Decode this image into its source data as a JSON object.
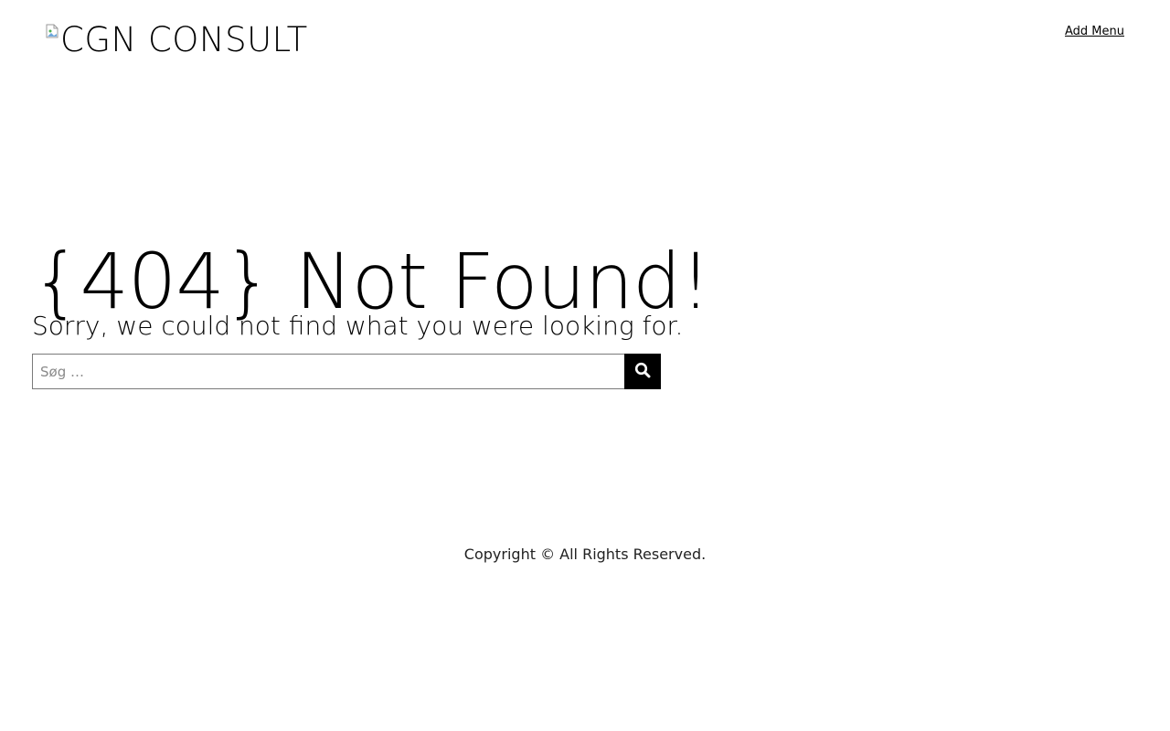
{
  "header": {
    "logo_text": "CGN CONSULT",
    "logo_icon": "broken-image-icon",
    "menu_link": "Add Menu"
  },
  "main": {
    "title": "{404} Not Found!",
    "subtitle": "Sorry, we could not find what you were looking for."
  },
  "search": {
    "placeholder": "Søg …",
    "value": "",
    "button_icon": "search-icon"
  },
  "footer": {
    "copyright": "Copyright © All Rights Reserved."
  },
  "colors": {
    "background": "#ffffff",
    "text": "#000000",
    "button_bg": "#000000",
    "input_border": "#7a7a7a"
  }
}
